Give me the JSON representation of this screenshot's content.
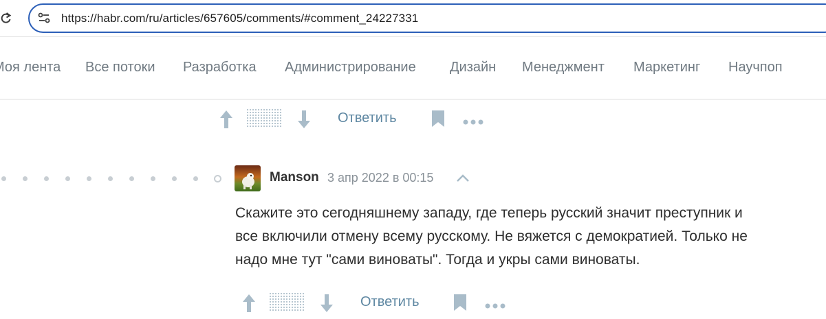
{
  "browser": {
    "url": "https://habr.com/ru/articles/657605/comments/#comment_24227331"
  },
  "nav": {
    "items": [
      {
        "label": "Моя лента"
      },
      {
        "label": "Все потоки"
      },
      {
        "label": "Разработка"
      },
      {
        "label": "Администрирование"
      },
      {
        "label": "Дизайн"
      },
      {
        "label": "Менеджмент"
      },
      {
        "label": "Маркетинг"
      },
      {
        "label": "Научпоп"
      }
    ]
  },
  "prev_comment": {
    "reply_label": "Ответить"
  },
  "comment": {
    "author": "Manson",
    "timestamp": "3 апр 2022 в 00:15",
    "lines": [
      "Скажите это сегодняшнему западу, где теперь русский значит преступник и",
      "все включили отмену всему русскому. Не вяжется с демократией. Только не",
      "надо мне тут \"сами виноваты\". Тогда и укры сами виноваты."
    ],
    "reply_label": "Ответить"
  },
  "colors": {
    "accent": "#5e87a2",
    "icon": "#a9bcc9",
    "omnibox_border": "#2c5fb8",
    "nav_text": "#707a82"
  },
  "icons": [
    "reload-icon",
    "site-info-icon",
    "vote-up-icon",
    "vote-down-icon",
    "bookmark-icon",
    "more-icon",
    "collapse-icon",
    "avatar"
  ]
}
